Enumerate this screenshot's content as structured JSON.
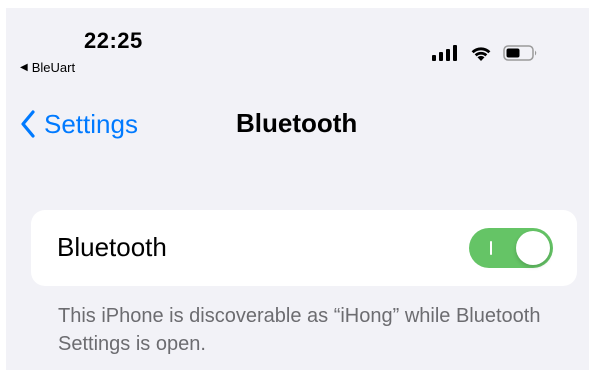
{
  "status_bar": {
    "time": "22:25",
    "back_app_arrow": "◀",
    "back_app_label": "BleUart",
    "icons": [
      "signal-icon",
      "wifi-icon",
      "battery-icon"
    ]
  },
  "nav": {
    "back_label": "Settings",
    "back_icon": "chevron-left-icon",
    "title": "Bluetooth"
  },
  "bluetooth_cell": {
    "label": "Bluetooth",
    "toggle_on": true
  },
  "footer": {
    "text": "This iPhone is discoverable as “iHong” while Bluetooth Settings is open."
  },
  "colors": {
    "accent": "#007aff",
    "toggle_on": "#65c466",
    "background": "#f2f2f7",
    "footer_text": "#6c6c70"
  }
}
